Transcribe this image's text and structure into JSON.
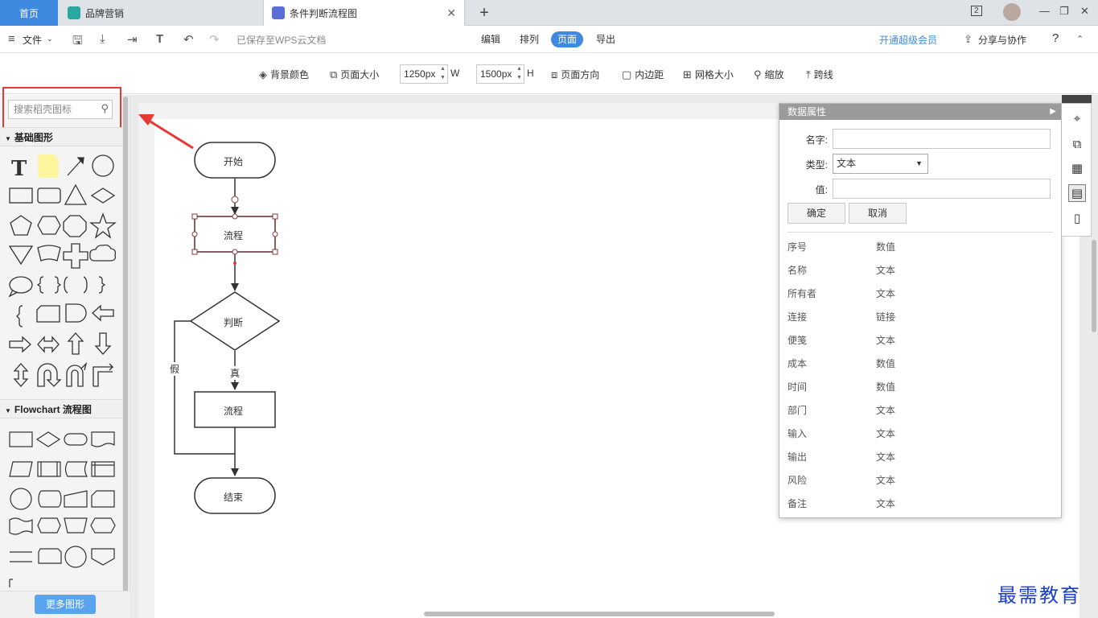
{
  "tabs": {
    "home": "首页",
    "brand": "品牌营销",
    "doc": "条件判断流程图",
    "close": "✕",
    "add": "+"
  },
  "window": {
    "badge": "2"
  },
  "menubar": {
    "file": "文件",
    "saved": "已保存至WPS云文档",
    "tabs": [
      "编辑",
      "排列",
      "页面",
      "导出"
    ],
    "active_tab": "页面",
    "vip": "开通超级会员",
    "share": "分享与协作",
    "help": "?"
  },
  "toolbar": {
    "bg_color": "背景颜色",
    "page_size": "页面大小",
    "width_value": "1250px",
    "width_label": "W",
    "height_value": "1500px",
    "height_label": "H",
    "orientation": "页面方向",
    "padding": "内边距",
    "grid_size": "网格大小",
    "zoom": "缩放",
    "cross_line": "跨线"
  },
  "left_panel": {
    "search_placeholder": "搜索稻壳图标",
    "basic_section": "基础图形",
    "flowchart_section": "Flowchart 流程图",
    "more_shapes": "更多图形"
  },
  "flowchart": {
    "start": "开始",
    "process1": "流程",
    "decision": "判断",
    "true_label": "真",
    "false_label": "假",
    "process2": "流程",
    "end": "结束"
  },
  "props_panel": {
    "title": "数据属性",
    "name_label": "名字:",
    "type_label": "类型:",
    "type_value": "文本",
    "value_label": "值:",
    "ok": "确定",
    "cancel": "取消",
    "rows": [
      {
        "k": "序号",
        "v": "数值"
      },
      {
        "k": "名称",
        "v": "文本"
      },
      {
        "k": "所有者",
        "v": "文本"
      },
      {
        "k": "连接",
        "v": "链接"
      },
      {
        "k": "便笺",
        "v": "文本"
      },
      {
        "k": "成本",
        "v": "数值"
      },
      {
        "k": "时间",
        "v": "数值"
      },
      {
        "k": "部门",
        "v": "文本"
      },
      {
        "k": "输入",
        "v": "文本"
      },
      {
        "k": "输出",
        "v": "文本"
      },
      {
        "k": "风险",
        "v": "文本"
      },
      {
        "k": "备注",
        "v": "文本"
      }
    ]
  },
  "watermark": "最需教育",
  "colors": {
    "accent": "#3f8ae0",
    "highlight": "#e53935"
  }
}
